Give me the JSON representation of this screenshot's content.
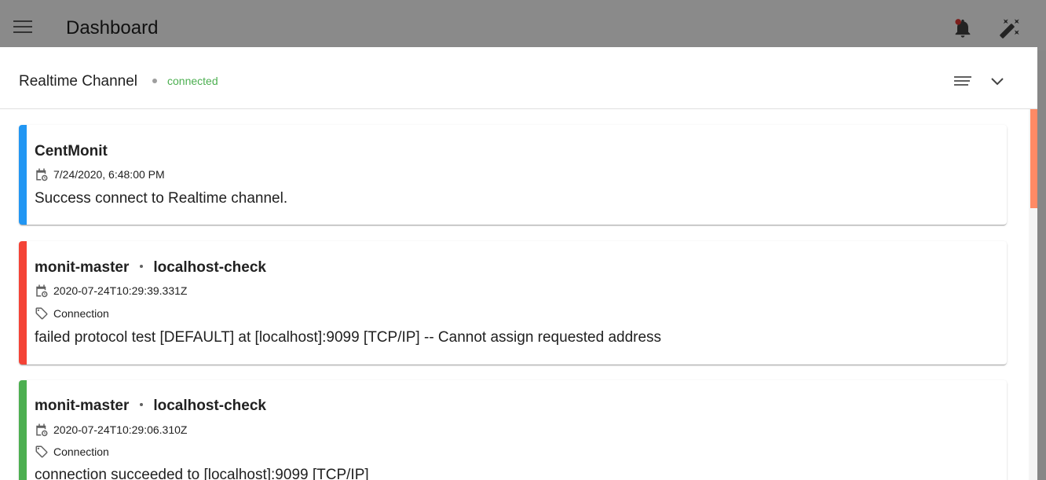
{
  "appbar": {
    "title": "Dashboard",
    "icons": [
      "menu-icon",
      "bell-icon",
      "theme-toggle-icon"
    ],
    "notification_dot_color": "#e53935"
  },
  "panel": {
    "title": "Realtime Channel",
    "status": "connected",
    "status_color": "#4caf50",
    "icons": [
      "sort-icon",
      "chevron-down-icon"
    ]
  },
  "events": [
    {
      "accent_color": "#2196f3",
      "host": "CentMonit",
      "check": "",
      "timestamp": "7/24/2020, 6:48:00 PM",
      "tag": "",
      "message": "Success connect to Realtime channel."
    },
    {
      "accent_color": "#f44336",
      "host": "monit-master",
      "check": "localhost-check",
      "timestamp": "2020-07-24T10:29:39.331Z",
      "tag": "Connection",
      "message": "failed protocol test [DEFAULT] at [localhost]:9099 [TCP/IP] -- Cannot assign requested address"
    },
    {
      "accent_color": "#4caf50",
      "host": "monit-master",
      "check": "localhost-check",
      "timestamp": "2020-07-24T10:29:06.310Z",
      "tag": "Connection",
      "message": "connection succeeded to [localhost]:9099 [TCP/IP]"
    }
  ]
}
